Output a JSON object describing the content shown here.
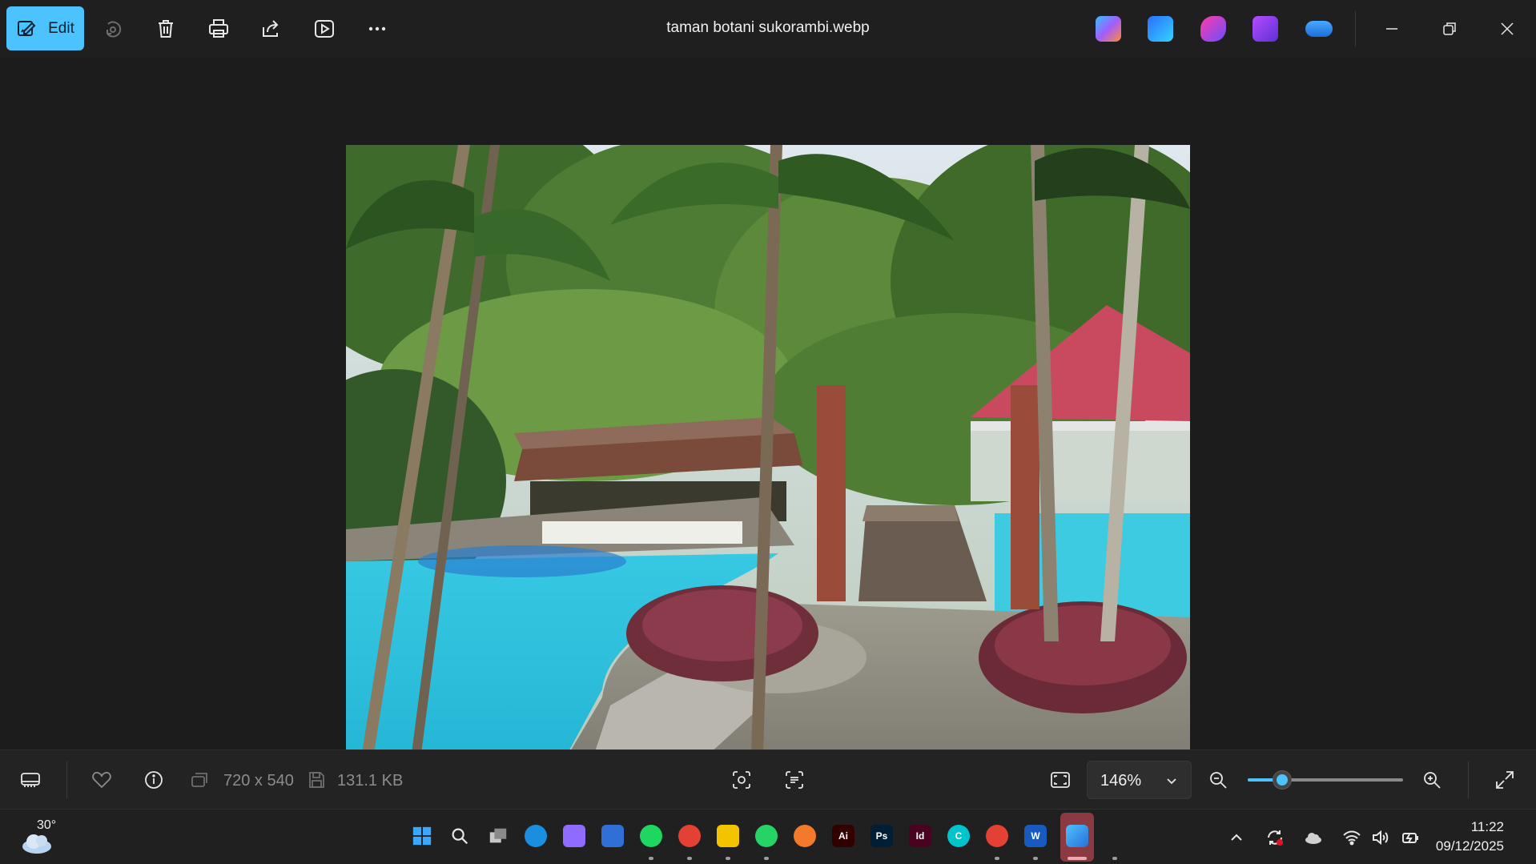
{
  "window": {
    "title": "taman botani sukorambi.webp"
  },
  "toolbar": {
    "edit_label": "Edit",
    "icons": [
      "edit-icon",
      "rotate-icon",
      "delete-icon",
      "print-icon",
      "share-icon",
      "slideshow-icon",
      "more-icon"
    ]
  },
  "app_shortcuts": [
    "copilot-icon",
    "designer-icon",
    "clipchamp-icon",
    "video-editor-icon",
    "onedrive-icon"
  ],
  "image": {
    "description_alt": "taman botani sukorambi.webp"
  },
  "infobar": {
    "dimensions": "720 x 540",
    "file_size": "131.1 KB",
    "zoom": "146%",
    "zoom_fraction": 0.22
  },
  "taskbar": {
    "weather_temp": "30°",
    "time": "11:22",
    "date": "09/12/2025",
    "apps": [
      {
        "name": "start",
        "label": "",
        "color": "#3aa0ff"
      },
      {
        "name": "search",
        "label": "",
        "color": "#202020"
      },
      {
        "name": "task-view",
        "label": "",
        "color": "#202020"
      },
      {
        "name": "edge",
        "label": "",
        "color": "#1a8fe0"
      },
      {
        "name": "copilot",
        "label": "",
        "color": "#8f6bff"
      },
      {
        "name": "store",
        "label": "",
        "color": "#2f6fd6"
      },
      {
        "name": "spotify",
        "label": "",
        "color": "#1ed760"
      },
      {
        "name": "chrome",
        "label": "",
        "color": "#e34133"
      },
      {
        "name": "file-explorer",
        "label": "",
        "color": "#f2c400"
      },
      {
        "name": "whatsapp",
        "label": "",
        "color": "#25d366"
      },
      {
        "name": "blender",
        "label": "",
        "color": "#f5792a"
      },
      {
        "name": "illustrator",
        "label": "Ai",
        "color": "#330000"
      },
      {
        "name": "photoshop",
        "label": "Ps",
        "color": "#001e36"
      },
      {
        "name": "indesign",
        "label": "Id",
        "color": "#49021f"
      },
      {
        "name": "canva",
        "label": "C",
        "color": "#00c4cc"
      },
      {
        "name": "chrome-2",
        "label": "",
        "color": "#e34133"
      },
      {
        "name": "word",
        "label": "W",
        "color": "#185abd"
      }
    ]
  }
}
